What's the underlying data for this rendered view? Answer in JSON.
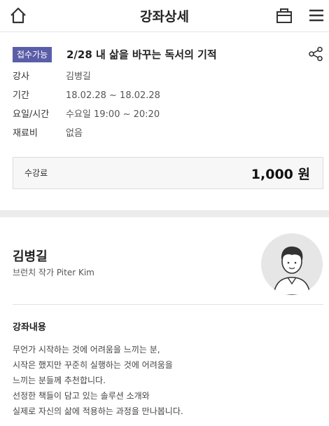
{
  "header": {
    "title": "강좌상세"
  },
  "course": {
    "status_badge": "접수가능",
    "title": "2/28 내 삶을 바꾸는 독서의 기적",
    "info": [
      {
        "label": "강사",
        "value": "김병길"
      },
      {
        "label": "기간",
        "value": "18.02.28 ~ 18.02.28"
      },
      {
        "label": "요일/시간",
        "value": "수요일 19:00 ~ 20:20"
      },
      {
        "label": "재료비",
        "value": "없음"
      }
    ],
    "fee": {
      "label": "수강료",
      "value": "1,000 원"
    }
  },
  "instructor": {
    "name": "김병길",
    "role": "브런치 작가 Piter Kim"
  },
  "content": {
    "title": "강좌내용",
    "lines": [
      "무언가 시작하는 것에 어려움을 느끼는 분,",
      "시작은 했지만 꾸준히 실행하는 것에 어려움을",
      "느끼는 분들께 추천합니다.",
      "선정한 책들이 담고 있는 솔루션 소개와",
      "실제로 자신의 삶에 적용하는 과정을 만나봅니다."
    ]
  },
  "icons": {
    "home": "home-icon",
    "bag": "shopping-bag-icon",
    "menu": "hamburger-menu-icon",
    "share": "share-icon",
    "avatar": "avatar-placeholder"
  },
  "colors": {
    "badge": "#5a5ea8",
    "fee_bg": "#f7f7f7",
    "divider": "#ececec"
  }
}
